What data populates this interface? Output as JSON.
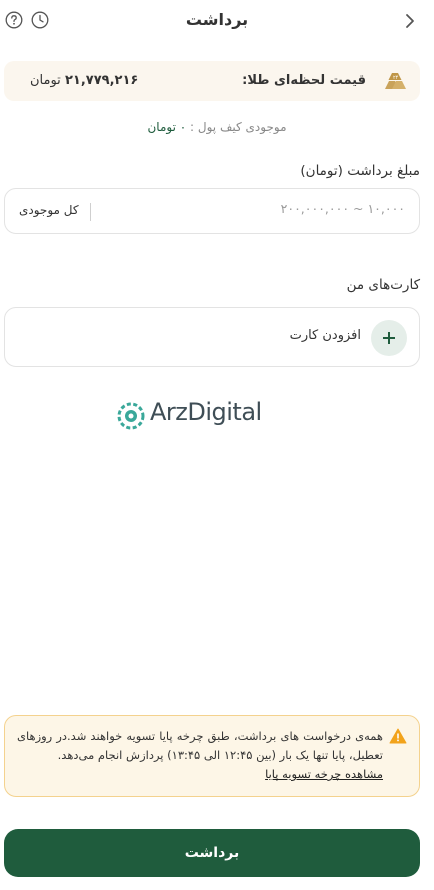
{
  "header": {
    "title": "برداشت"
  },
  "gold_price": {
    "label": "قیمت لحظه‌ای طلا:",
    "value": "۲۱,۷۷۹,۲۱۶",
    "unit": "تومان"
  },
  "wallet": {
    "label": "موجودی کیف پول :",
    "amount": "۰",
    "unit": "تومان"
  },
  "amount_field": {
    "label": "مبلغ برداشت (تومان)",
    "placeholder": "۱۰,۰۰۰ ~ ۲۰۰,۰۰۰,۰۰۰",
    "value": "",
    "all_balance": "کل موجودی"
  },
  "cards": {
    "label": "کارت‌های من",
    "add_label": "افزودن کارت"
  },
  "watermark": {
    "text": "ArzDigital"
  },
  "notice": {
    "text": "همه‌ی درخواست های برداشت، طبق چرخه پایا تسویه خواهند شد.در روزهای تعطیل، پایا تنها یک بار (بین ۱۲:۴۵ الی ۱۳:۴۵) پردازش انجام می‌دهد.",
    "link": "مشاهده چرخه تسویه پایا"
  },
  "submit": {
    "label": "برداشت"
  },
  "colors": {
    "brand": "#1f5c3d",
    "notice_bg": "#fdf6e7",
    "notice_border": "#f4d28e",
    "gold": "#c9a35b"
  }
}
